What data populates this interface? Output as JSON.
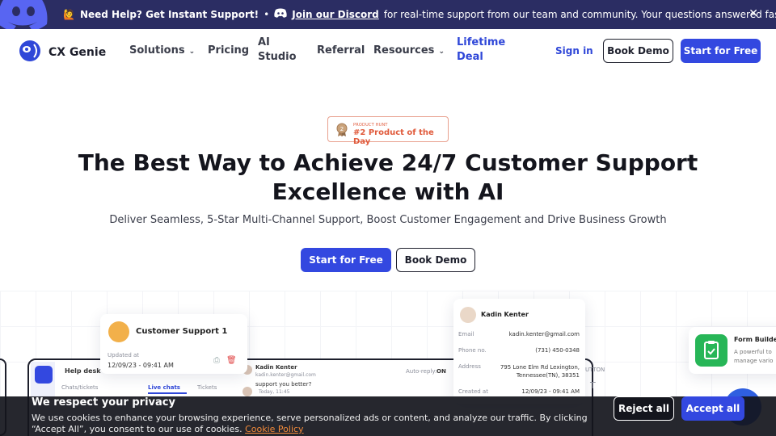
{
  "announcement": {
    "emoji": "🙋",
    "help_text": "Need Help? Get Instant Support!",
    "separator": "•",
    "discord_link": "Join our Discord",
    "rest_text": "for real-time support from our team and community. Your questions answered fast!",
    "close_icon": "close-icon"
  },
  "nav": {
    "brand": "CX Genie",
    "items": {
      "solutions": "Solutions",
      "pricing": "Pricing",
      "ai_studio_1": "AI",
      "ai_studio_2": "Studio",
      "referral": "Referral",
      "resources": "Resources",
      "lifetime_1": "Lifetime",
      "lifetime_2": "Deal"
    },
    "chevron": "⌄",
    "sign_in": "Sign in",
    "book_demo": "Book Demo",
    "start_free": "Start for Free"
  },
  "hero": {
    "badge_small": "PRODUCT HUNT",
    "badge_title": "#2 Product of the Day",
    "title_line1": "The Best Way to Achieve 24/7 Customer Support",
    "title_line2": "Excellence with AI",
    "subtitle": "Deliver Seamless, 5-Star Multi-Channel Support, Boost Customer Engagement and Drive Business Growth",
    "start_free": "Start for Free",
    "book_demo": "Book Demo"
  },
  "preview": {
    "cs_card": {
      "name": "Customer Support 1",
      "updated_label": "Updated at",
      "date": "12/09/23 - 09:41 AM"
    },
    "app": {
      "help_desk": "Help desk",
      "chats_tickets": "Chats/tickets",
      "live_chats": "Live chats",
      "tickets": "Tickets",
      "contact_name": "Kadin Kenter",
      "contact_email": "kadin.kenter@gmail.com",
      "message": "support you better?",
      "time": "Today, 11:45",
      "auto_reply": "Auto-reply:",
      "auto_reply_state": "ON",
      "button_label": "UTTON",
      "text_tool": "T"
    },
    "contact_card": {
      "name": "Kadin Kenter",
      "rows": [
        {
          "k": "Email",
          "v": "kadin.kenter@gmail.com"
        },
        {
          "k": "Phone no.",
          "v": "(731) 450-0348"
        },
        {
          "k": "Address",
          "v": "795 Lone Elm Rd Lexington, Tennessee(TN), 38351"
        },
        {
          "k": "Created at",
          "v": "12/09/23 - 09:41 AM"
        }
      ]
    },
    "form_card": {
      "title": "Form Builde",
      "desc_1": "A powerful to",
      "desc_2": "manage vario"
    }
  },
  "cookie": {
    "title": "We respect your privacy",
    "text": "We use cookies to enhance your browsing experience, serve personalized ads or content, and analyze our traffic. By clicking “Accept All”, you consent to our use of cookies.",
    "policy_link": "Cookie Policy",
    "reject": "Reject all",
    "accept": "Accept all"
  },
  "colors": {
    "topbar": "#2b2d63",
    "primary": "#3348e0",
    "lifetime": "#2f47d8",
    "badge": "#e05a3b"
  }
}
